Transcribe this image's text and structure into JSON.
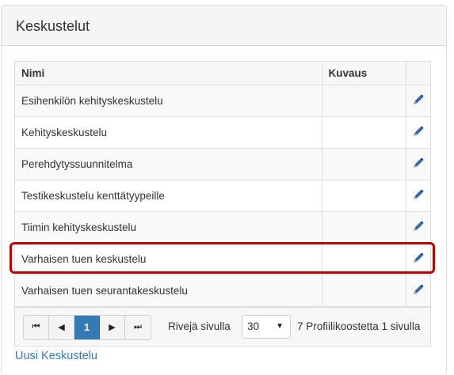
{
  "panel": {
    "title": "Keskustelut"
  },
  "table": {
    "headers": {
      "name": "Nimi",
      "description": "Kuvaus"
    },
    "rows": [
      {
        "name": "Esihenkilön kehityskeskustelu",
        "description": ""
      },
      {
        "name": "Kehityskeskustelu",
        "description": ""
      },
      {
        "name": "Perehdytyssuunnitelma",
        "description": ""
      },
      {
        "name": "Testikeskustelu kenttätyypeille",
        "description": ""
      },
      {
        "name": "Tiimin kehityskeskustelu",
        "description": ""
      },
      {
        "name": "Varhaisen tuen keskustelu",
        "description": ""
      },
      {
        "name": "Varhaisen tuen seurantakeskustelu",
        "description": ""
      }
    ],
    "edit_icon": "pencil-icon"
  },
  "pager": {
    "first": "⏮",
    "prev": "◀",
    "current_page": "1",
    "next": "▶",
    "last": "⏭",
    "rows_label": "Rivejä sivulla",
    "rows_value": "30",
    "info": "7 Profiilikoostetta 1 sivulla"
  },
  "new_link": "Uusi Keskustelu",
  "colors": {
    "accent": "#337ab7",
    "highlight": "#c00000"
  }
}
